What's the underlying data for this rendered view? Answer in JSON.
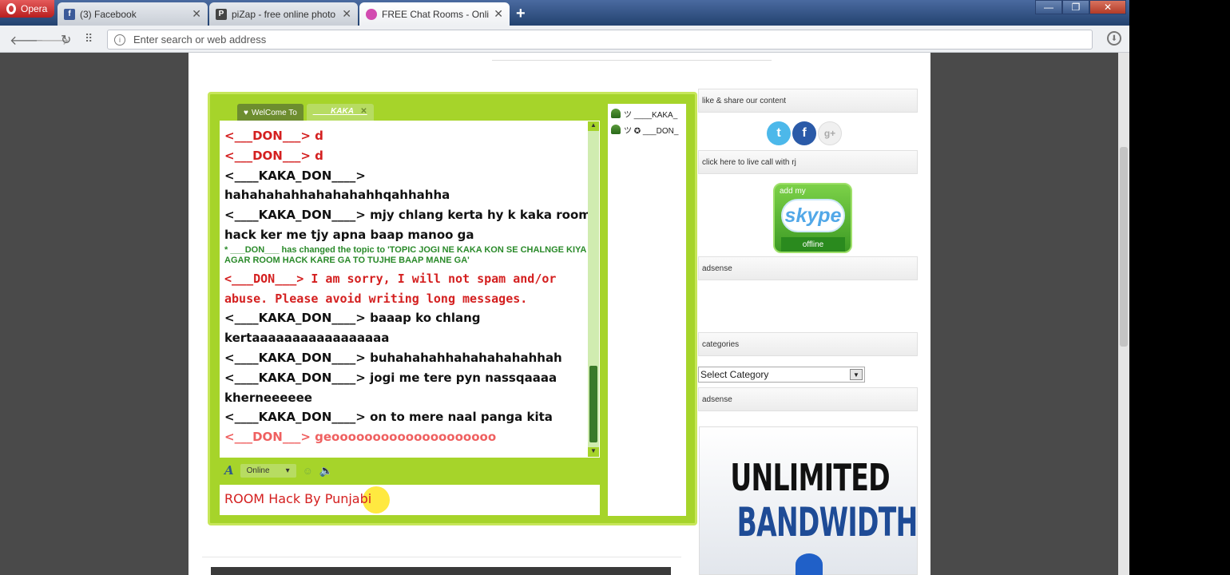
{
  "browser": {
    "opera_label": "Opera",
    "tabs": [
      {
        "title": "(3) Facebook",
        "icon": "facebook-icon",
        "color": "#3b5998",
        "glyph": "f"
      },
      {
        "title": "piZap - free online photo",
        "icon": "pizap-icon",
        "color": "#444",
        "glyph": "P"
      },
      {
        "title": "FREE Chat Rooms - Online",
        "icon": "chat-icon",
        "color": "#d24bb0",
        "glyph": ""
      }
    ],
    "address_placeholder": "Enter search or web address"
  },
  "chat": {
    "welcome_tab": "WelCome To",
    "room_tab": "____KAKA_",
    "messages": [
      {
        "text": "<___DON___> d",
        "style": "red"
      },
      {
        "text": "<___DON___> d",
        "style": "red"
      },
      {
        "text": "<____KAKA_DON____>",
        "style": "normal"
      },
      {
        "text": "hahahahahhahahahahhqahhahha",
        "style": "normal"
      },
      {
        "text": "<____KAKA_DON____> mjy chlang kerta hy k kaka room hack ker me tjy apna baap manoo ga",
        "style": "normal"
      },
      {
        "text": "* ___DON___ has changed the topic to 'TOPIC JOGI NE KAKA KON SE CHALNGE KIYA K AGAR ROOM HACK KARE GA TO TUJHE BAAP MANE GA'",
        "style": "sys"
      },
      {
        "text": "<___DON___> I am sorry, I will not spam and/or abuse. Please avoid writing long messages.",
        "style": "warn"
      },
      {
        "text": "<____KAKA_DON____> baaap ko chlang kertaaaaaaaaaaaaaaaaa",
        "style": "normal"
      },
      {
        "text": "<____KAKA_DON____> buhahahahhahahahahahhah",
        "style": "normal"
      },
      {
        "text": "<____KAKA_DON____> jogi me tere pyn nassqaaaa kherneeeeee",
        "style": "normal"
      },
      {
        "text": "<____KAKA_DON____> on to mere naal panga kita",
        "style": "normal"
      },
      {
        "text": "<___DON___> geoooooooooooooooooooo",
        "style": "faint"
      }
    ],
    "users": [
      "ツ ____KAKA_",
      "ツ ✪ ___DON_"
    ],
    "status": "Online",
    "input_value": "ROOM Hack By Punjabi"
  },
  "sidebar": {
    "like_share": "like & share our content",
    "live_call": "click here to live call with rj",
    "adsense1": "adsense",
    "categories": "categories",
    "category_select": "Select Category",
    "adsense2": "adsense",
    "skype_add": "add my",
    "skype_logo": "skype",
    "skype_status": "offline",
    "ad_line1": "UNLIMITED",
    "ad_line2": "BANDWIDTH"
  },
  "colors": {
    "chat_green": "#a6d42a",
    "nick_red": "#d42020",
    "topic_green": "#2a8a2a"
  }
}
